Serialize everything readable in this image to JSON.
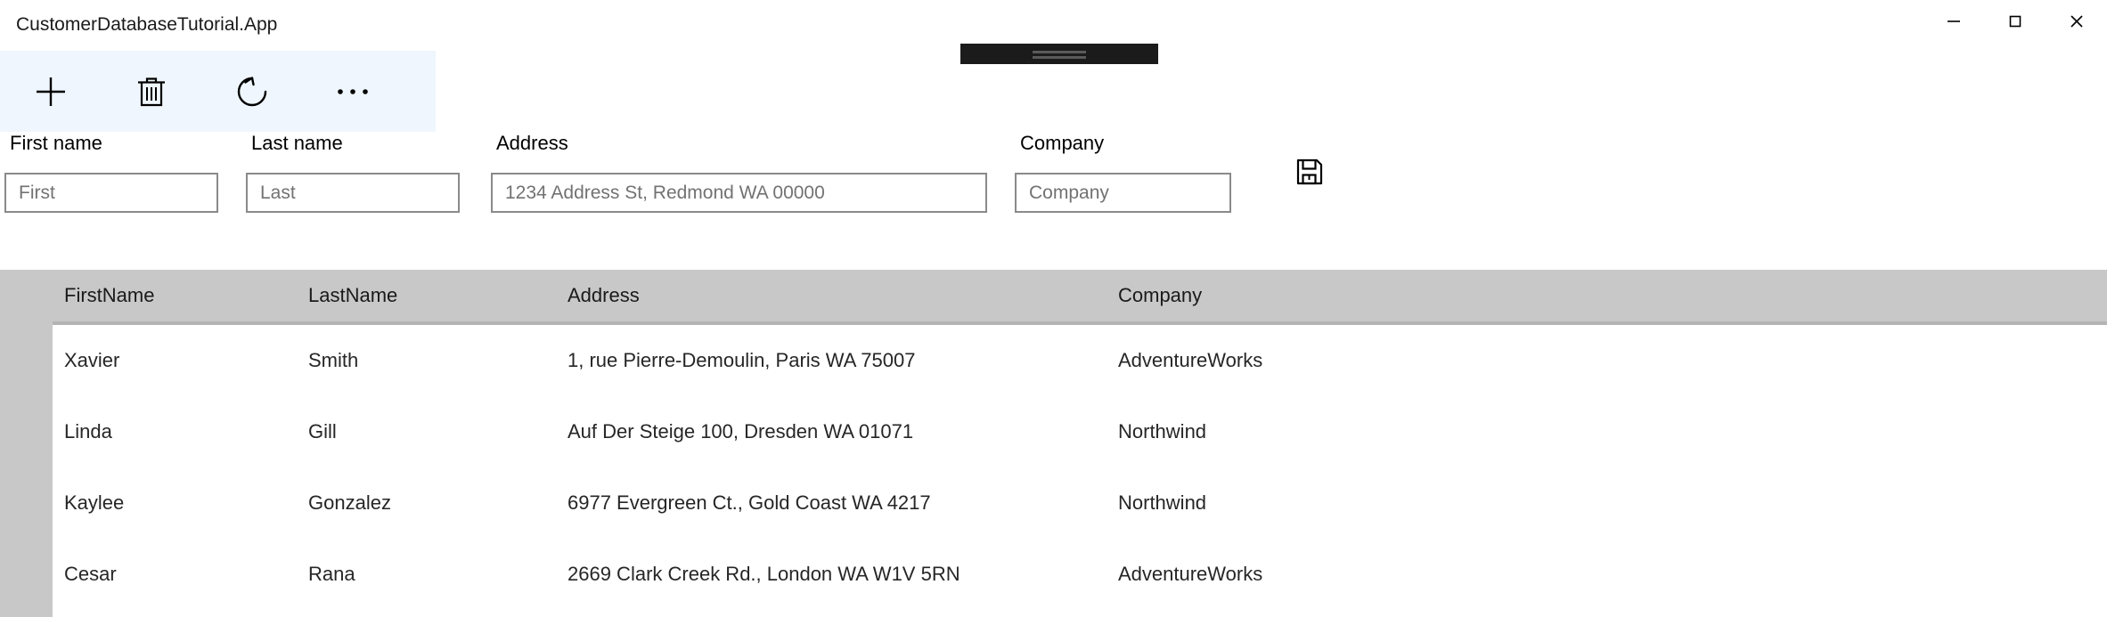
{
  "window": {
    "title": "CustomerDatabaseTutorial.App",
    "controls": [
      {
        "name": "minimize",
        "label": "Minimize"
      },
      {
        "name": "maximize",
        "label": "Maximize"
      },
      {
        "name": "close",
        "label": "Close"
      }
    ]
  },
  "snap_overlay": {
    "visible": true,
    "color": "#1b1b1b",
    "handle_color": "#5a5a5a"
  },
  "commandbar": {
    "background": "#eff6fd",
    "buttons": [
      {
        "icon": "add-icon",
        "label": "Add"
      },
      {
        "icon": "delete-icon",
        "label": "Delete"
      },
      {
        "icon": "refresh-icon",
        "label": "Refresh"
      },
      {
        "icon": "more-icon",
        "label": "See more"
      }
    ]
  },
  "form": {
    "fields": [
      {
        "label": "First name",
        "placeholder": "First",
        "value": ""
      },
      {
        "label": "Last name",
        "placeholder": "Last",
        "value": ""
      },
      {
        "label": "Address",
        "placeholder": "1234 Address St, Redmond WA 00000",
        "value": ""
      },
      {
        "label": "Company",
        "placeholder": "Company",
        "value": ""
      }
    ],
    "save_button": {
      "icon": "save-icon",
      "label": "Save"
    }
  },
  "grid": {
    "header_background": "#c8c8c8",
    "columns": [
      "FirstName",
      "LastName",
      "Address",
      "Company"
    ],
    "rows": [
      {
        "FirstName": "Xavier",
        "LastName": "Smith",
        "Address": "1, rue Pierre-Demoulin, Paris WA 75007",
        "Company": "AdventureWorks"
      },
      {
        "FirstName": "Linda",
        "LastName": "Gill",
        "Address": "Auf Der Steige 100, Dresden WA 01071",
        "Company": "Northwind"
      },
      {
        "FirstName": "Kaylee",
        "LastName": "Gonzalez",
        "Address": "6977 Evergreen Ct., Gold Coast WA 4217",
        "Company": "Northwind"
      },
      {
        "FirstName": "Cesar",
        "LastName": "Rana",
        "Address": "2669 Clark Creek Rd., London WA W1V 5RN",
        "Company": "AdventureWorks"
      }
    ]
  }
}
